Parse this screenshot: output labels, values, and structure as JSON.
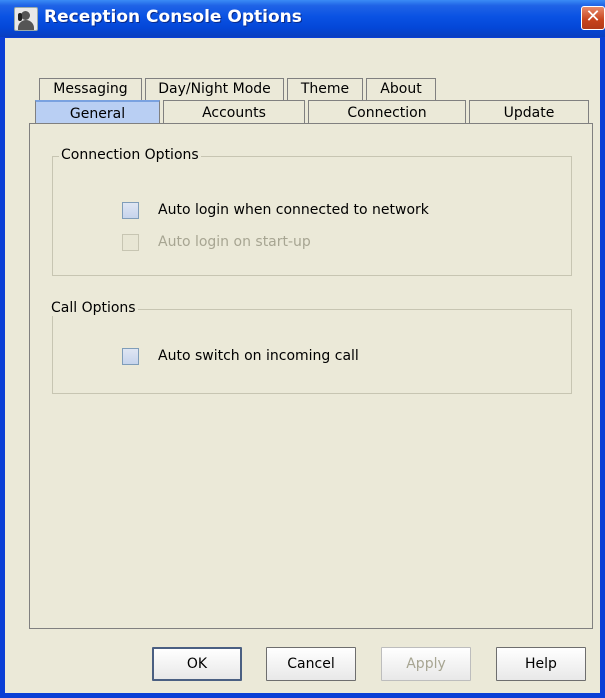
{
  "window": {
    "title": "Reception Console Options",
    "close_symbol": "✕"
  },
  "tabs_row1": [
    {
      "label": "Messaging"
    },
    {
      "label": "Day/Night Mode"
    },
    {
      "label": "Theme"
    },
    {
      "label": "About"
    }
  ],
  "tabs_row2": [
    {
      "label": "General",
      "selected": true
    },
    {
      "label": "Accounts"
    },
    {
      "label": "Connection"
    },
    {
      "label": "Update"
    }
  ],
  "connection_options": {
    "title": "Connection Options",
    "auto_login_network": {
      "label": "Auto login when connected to network",
      "checked": false,
      "enabled": true
    },
    "auto_login_startup": {
      "label": "Auto login on start-up",
      "checked": false,
      "enabled": false
    }
  },
  "call_options": {
    "title": "Call Options",
    "auto_switch": {
      "label": "Auto switch on incoming call",
      "checked": false,
      "enabled": true
    }
  },
  "buttons": {
    "ok": "OK",
    "cancel": "Cancel",
    "apply": "Apply",
    "help": "Help"
  },
  "colors": {
    "title_bar": "#0a52e3",
    "selected_tab": "#b9cff3",
    "dialog_bg": "#ebe9d8",
    "disabled_text": "#a7a592"
  }
}
